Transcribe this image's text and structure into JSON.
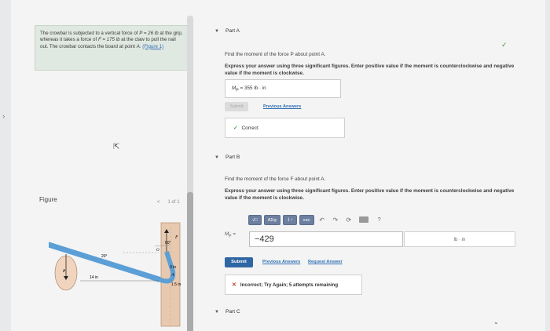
{
  "problem": {
    "text_1": "The crowbar is subjected to a vertical force of ",
    "F_P": "P = 26 lb",
    "text_2": " at the grip, whereas it takes a force of ",
    "F_F": "F = 175 lb",
    "text_3": " at the claw to pull the nail out. The crowbar contacts the board at point ",
    "point": "A",
    "text_4": ". ",
    "figure_link": "(Figure 1)"
  },
  "figure": {
    "label": "Figure",
    "pager": {
      "prev": "<",
      "current": "1 of 1",
      "next": ">"
    },
    "annotations": {
      "F": "F",
      "angle60": "60°",
      "O": "O",
      "A": "A",
      "dim3": "3 in",
      "dim15": "1.5 in",
      "angle20": "20°",
      "P": "P",
      "dim14": "14 in"
    }
  },
  "partA": {
    "title": "Part A",
    "question": "Find the moment of the force P about point A.",
    "instructions": "Express your answer using three significant figures. Enter positive value if the moment is counterclockwise and negative value if the moment is clockwise.",
    "answer_label": "M",
    "answer_sub": "P",
    "answer_value": " = 355 lb · in",
    "submit_label": "Submit",
    "prev_answers": "Previous Answers",
    "feedback": "Correct"
  },
  "partB": {
    "title": "Part B",
    "question": "Find the moment of the force F about point A.",
    "instructions": "Express your answer using three significant figures. Enter positive value if the moment is counterclockwise and negative value if the moment is clockwise.",
    "toolbar": {
      "templates": "√□",
      "greek": "ΑΣφ",
      "vectors_sep": "⇃↑",
      "vec": "vec",
      "undo": "↶",
      "redo": "↷",
      "reset": "⟳",
      "help": "?"
    },
    "math_label": "M",
    "math_sub": "F",
    "math_eq": " =",
    "input_value": "−429",
    "units": "lb · in",
    "submit_label": "Submit",
    "prev_answers": "Previous Answers",
    "request_answer": "Request Answer",
    "feedback": "Incorrect; Try Again; 5 attempts remaining"
  },
  "partC": {
    "title": "Part C"
  },
  "colors": {
    "accent": "#2f66a4",
    "correct": "#3c9b3c",
    "incorrect": "#c0392b",
    "panel": "#dfe8e1"
  }
}
